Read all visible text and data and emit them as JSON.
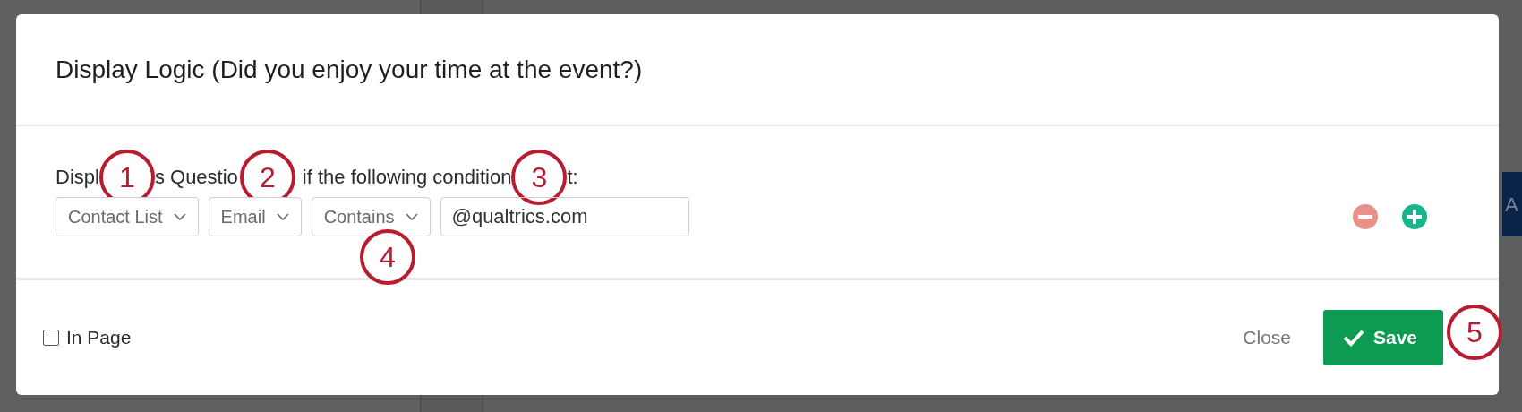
{
  "background": {
    "button": "A"
  },
  "dialog": {
    "title": "Display Logic (Did you enjoy your time at the event?)",
    "intro_fragments": [
      "Displ",
      "s Questio",
      "if the following condition",
      "t:"
    ],
    "condition": {
      "dropdowns": [
        {
          "label": "Contact List"
        },
        {
          "label": "Email"
        },
        {
          "label": "Contains"
        }
      ],
      "value": "@qualtrics.com"
    },
    "in_page": {
      "label": "In Page",
      "checked": false
    },
    "buttons": {
      "close": "Close",
      "save": "Save"
    }
  },
  "callouts": [
    {
      "number": "1"
    },
    {
      "number": "2"
    },
    {
      "number": "3"
    },
    {
      "number": "4"
    },
    {
      "number": "5"
    }
  ]
}
